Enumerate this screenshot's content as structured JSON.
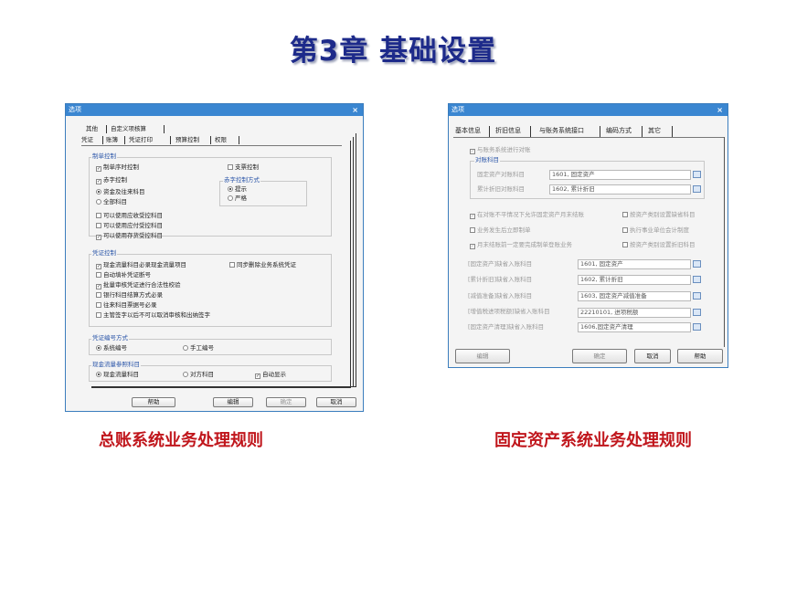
{
  "slide_title": "第3章  基础设置",
  "captions": {
    "left": "总账系统业务处理规则",
    "right": "固定资产系统业务处理规则"
  },
  "left": {
    "title": "选项",
    "close": "×",
    "tabs_row1": [
      "其他",
      "自定义项核算"
    ],
    "tabs_row2": [
      "凭证",
      "账簿",
      "凭证打印",
      "预算控制",
      "权限"
    ],
    "g_zhidan": "制单控制",
    "cb_xuhao": "制单序时控制",
    "cb_zhipiao": "支票控制",
    "cb_chizi": "赤字控制",
    "rb_zijin": "资金及往来科目",
    "rb_quanbu": "全部科目",
    "g_chizi_mode": "赤字控制方式",
    "rb_tishi": "提示",
    "rb_yange": "严格",
    "cb_yingshou": "可以使用应收受控科目",
    "cb_yingfu": "可以使用应付受控科目",
    "cb_cunhuo": "可以使用存货受控科目",
    "g_pingzheng": "凭证控制",
    "cb_xianjin": "现金流量科目必录现金流量项目",
    "cb_tongbu": "同步删除业务系统凭证",
    "cb_tianbu": "自动填补凭证断号",
    "cb_piliang": "批量审核凭证进行合法性校验",
    "cb_yinhang": "银行科目结算方式必录",
    "cb_wanglai": "往来科目票据号必录",
    "cb_zhuguan": "主管签字以后不可以取消审核和出纳签字",
    "g_bianhao": "凭证编号方式",
    "rb_xitong": "系统编号",
    "rb_shougong": "手工编号",
    "g_cashflow": "现金流量参照科目",
    "rb_xjll": "现金流量科目",
    "rb_duifang": "对方科目",
    "cb_zidong": "自动显示",
    "btn_help": "帮助",
    "btn_edit": "编辑",
    "btn_ok": "确定",
    "btn_cancel": "取消"
  },
  "right": {
    "title": "选项",
    "close": "×",
    "tabs": [
      "基本信息",
      "折旧信息",
      "与账务系统接口",
      "编码方式",
      "其它"
    ],
    "cb_duizhang": "与账务系统进行对账",
    "g_duizhang": "对账科目",
    "lbl_gdzc": "固定资产对账科目",
    "val_gdzc": "1601, 固定资产",
    "lbl_ljzj": "累计折旧对账科目",
    "val_ljzj": "1602, 累计折旧",
    "cb_buping": "在对账不平情况下允许固定资产月末结账",
    "cb_leibie_que": "按资产类别设置缺省科目",
    "cb_houzhidan": "业务发生后立即制单",
    "cb_shiye": "执行事业单位会计制度",
    "cb_yuemo": "月末结账前一定要完成制单登账业务",
    "cb_leibie_zj": "按资产类别设置折旧科目",
    "rows": [
      {
        "label": "[固定资产]缺省入账科目",
        "value": "1601, 固定资产"
      },
      {
        "label": "[累计折旧]缺省入账科目",
        "value": "1602, 累计折旧"
      },
      {
        "label": "[减值准备]缺省入账科目",
        "value": "1603, 固定资产减值准备"
      },
      {
        "label": "[增值税进项税额]缺省入账科目",
        "value": "22210101, 进项税额"
      },
      {
        "label": "[固定资产清理]缺省入账科目",
        "value": "1606,固定资产清理"
      }
    ],
    "btn_edit": "编辑",
    "btn_ok": "确定",
    "btn_cancel": "取消",
    "btn_help": "帮助"
  }
}
